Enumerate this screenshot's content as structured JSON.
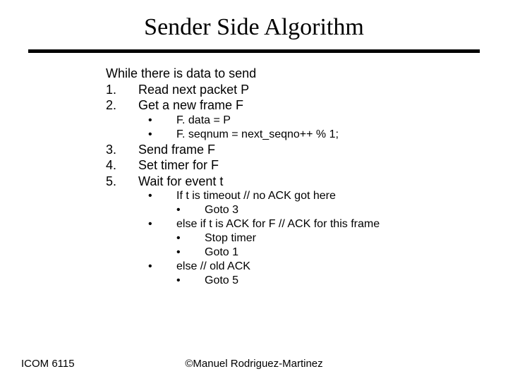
{
  "title": "Sender Side Algorithm",
  "body": {
    "while": "While there is data to send",
    "steps": [
      {
        "num": "1.",
        "text": "Read next packet  P"
      },
      {
        "num": "2.",
        "text": "Get a new frame F",
        "sub": [
          {
            "bullet": "•",
            "text": "F. data = P"
          },
          {
            "bullet": "•",
            "text": "F. seqnum = next_seqno++ % 1;"
          }
        ]
      },
      {
        "num": "3.",
        "text": "Send frame F"
      },
      {
        "num": "4.",
        "text": "Set timer for F"
      },
      {
        "num": "5.",
        "text": "Wait for event t",
        "sub": [
          {
            "bullet": "•",
            "text": "If t is timeout  // no ACK got here",
            "sub": [
              {
                "bullet": "•",
                "text": "Goto 3"
              }
            ]
          },
          {
            "bullet": "•",
            "text": "else if t is ACK for F // ACK for this frame",
            "sub": [
              {
                "bullet": "•",
                "text": "Stop timer"
              },
              {
                "bullet": "•",
                "text": "Goto 1"
              }
            ]
          },
          {
            "bullet": "•",
            "text": "else // old ACK",
            "sub": [
              {
                "bullet": "•",
                "text": "Goto 5"
              }
            ]
          }
        ]
      }
    ]
  },
  "footer": {
    "left": "ICOM 6115",
    "center": "©Manuel Rodriguez-Martinez"
  }
}
